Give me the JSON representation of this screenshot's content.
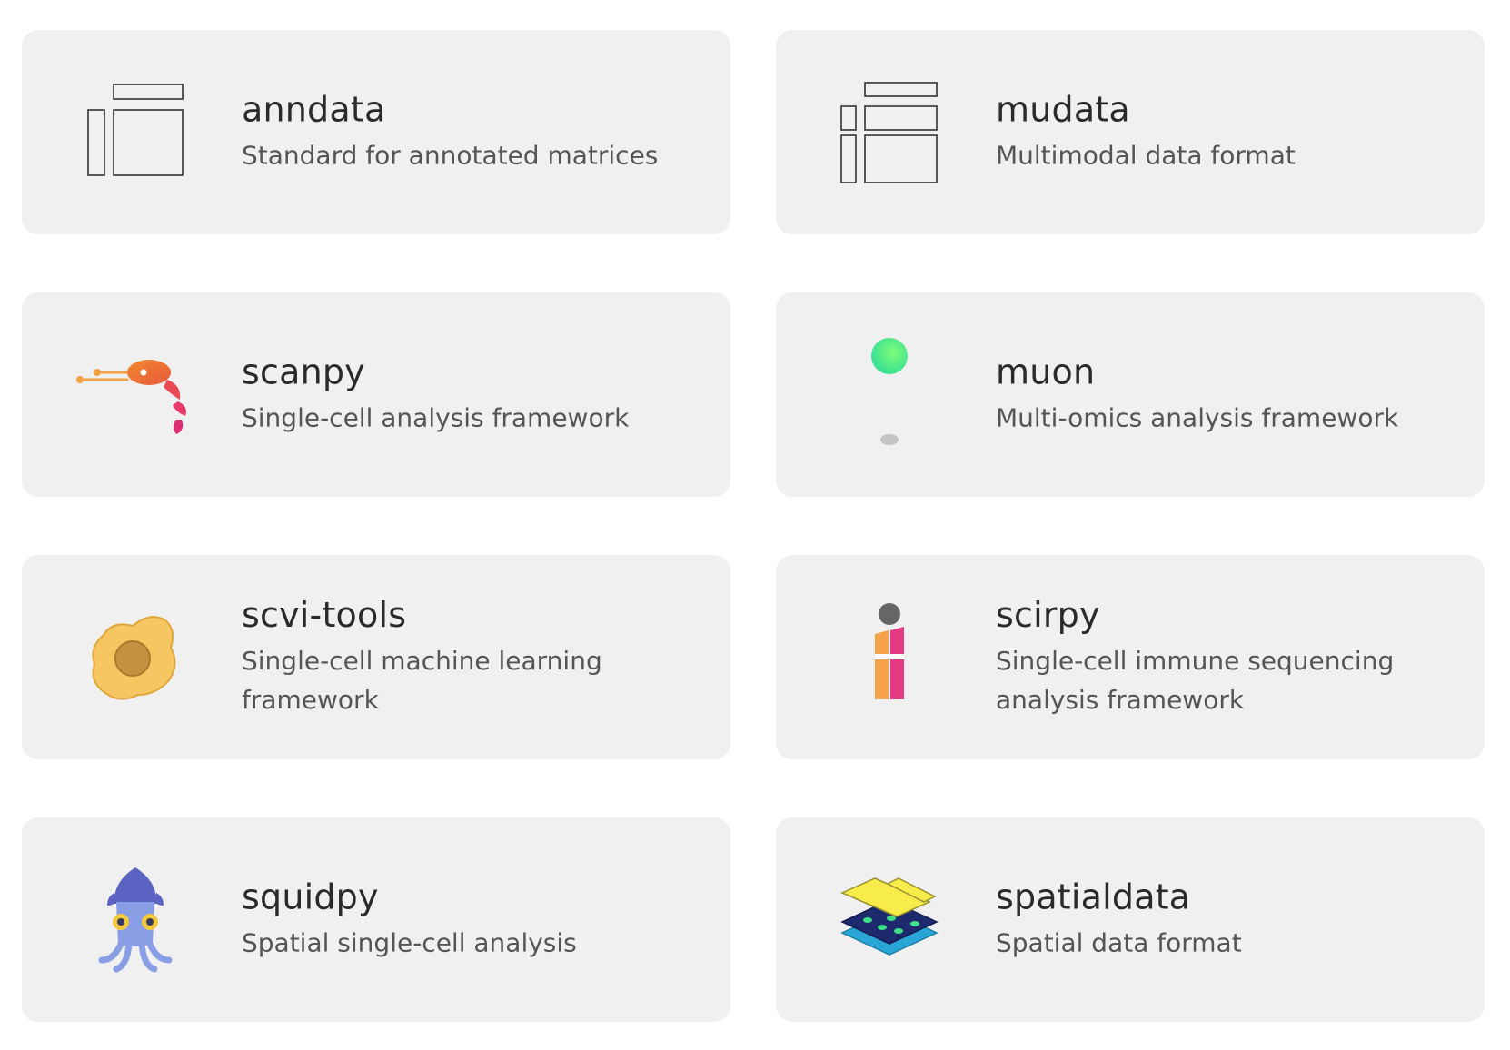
{
  "cards": [
    {
      "title": "anndata",
      "description": "Standard for annotated matrices",
      "icon": "anndata-matrix-icon"
    },
    {
      "title": "mudata",
      "description": "Multimodal data format",
      "icon": "mudata-matrix-icon"
    },
    {
      "title": "scanpy",
      "description": "Single-cell analysis framework",
      "icon": "scanpy-shrimp-icon"
    },
    {
      "title": "muon",
      "description": "Multi-omics analysis framework",
      "icon": "muon-particle-icon"
    },
    {
      "title": "scvi-tools",
      "description": "Single-cell machine learning framework",
      "icon": "scvi-tools-egg-icon"
    },
    {
      "title": "scirpy",
      "description": "Single-cell immune sequencing analysis framework",
      "icon": "scirpy-i-icon"
    },
    {
      "title": "squidpy",
      "description": "Spatial single-cell analysis",
      "icon": "squidpy-squid-icon"
    },
    {
      "title": "spatialdata",
      "description": "Spatial data format",
      "icon": "spatialdata-layers-icon"
    }
  ],
  "colors": {
    "card_bg": "#f0f0f0",
    "title": "#2a2a2a",
    "description": "#555555"
  }
}
